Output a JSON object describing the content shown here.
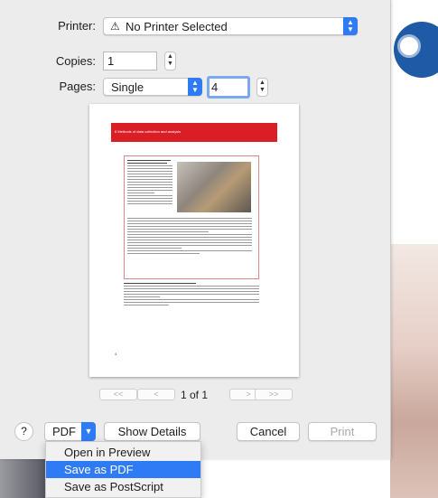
{
  "printer": {
    "label": "Printer:",
    "value": "No Printer Selected",
    "warning_icon": "warning-icon"
  },
  "copies": {
    "label": "Copies:",
    "value": "1"
  },
  "pages": {
    "label": "Pages:",
    "mode": "Single",
    "page_number": "4"
  },
  "preview": {
    "banner": "6 Methods of data collection and analysis",
    "page_num": "4",
    "pager_first": "<<",
    "pager_prev": "<",
    "pager_next": ">",
    "pager_last": ">>",
    "page_indicator": "1 of 1"
  },
  "bottom": {
    "help": "?",
    "pdf": "PDF",
    "show_details": "Show Details",
    "cancel": "Cancel",
    "print": "Print"
  },
  "pdf_menu": {
    "items": [
      "Open in Preview",
      "Save as PDF",
      "Save as PostScript"
    ],
    "selected": "Save as PDF"
  },
  "colors": {
    "accent": "#2f7bf5",
    "banner": "#d91e26"
  }
}
